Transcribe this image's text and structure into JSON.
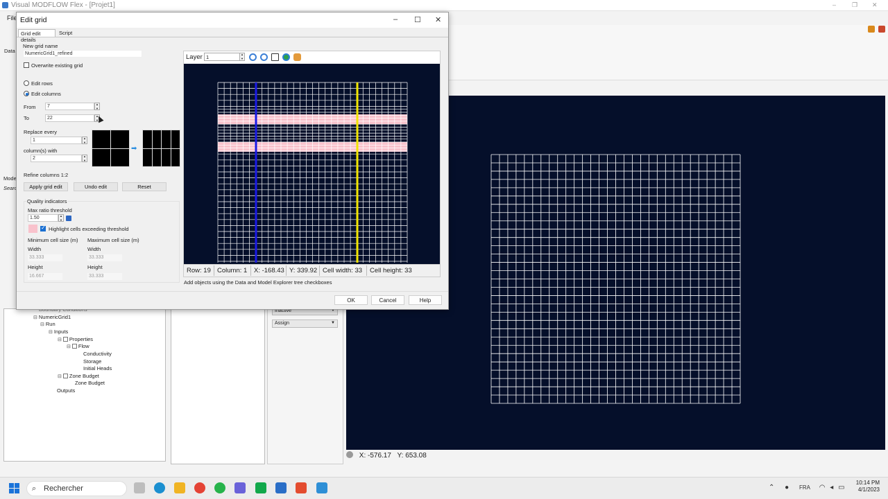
{
  "app": {
    "title": "Visual MODFLOW Flex - [Projet1]",
    "menu_first": "File",
    "panel_label_data": "Data",
    "panel_label_model": "Mode",
    "panel_label_search": "Searc"
  },
  "background_tree": {
    "boundary": "Boundary Conditions",
    "grid": "NumericGrid1",
    "run": "Run",
    "inputs": "Inputs",
    "properties": "Properties",
    "flow": "Flow",
    "conductivity": "Conductivity",
    "storage": "Storage",
    "initial_heads": "Initial Heads",
    "zone_budget": "Zone Budget",
    "zone_budget_child": "Zone Budget",
    "outputs": "Outputs"
  },
  "background_props": {
    "dropdown1": "Inactive",
    "dropdown2": "Assign"
  },
  "background_coords": {
    "x": "X: -576.17",
    "y": "Y: 653.08"
  },
  "dialog": {
    "title": "Edit grid",
    "tabs": [
      "Grid edit details",
      "Script"
    ],
    "new_grid_name_label": "New grid name",
    "new_grid_name_value": "NumericGrid1_refined",
    "overwrite_label": "Overwrite existing grid",
    "overwrite_checked": false,
    "edit_rows_label": "Edit rows",
    "edit_columns_label": "Edit columns",
    "edit_mode": "columns",
    "from_label": "From",
    "from_value": "7",
    "to_label": "To",
    "to_value": "22",
    "replace_every_label": "Replace every",
    "replace_every_value": "1",
    "columns_with_label": "column(s) with",
    "columns_with_value": "2",
    "refine_label": "Refine columns 1:2",
    "apply_button": "Apply grid edit",
    "undo_button": "Undo edit",
    "reset_button": "Reset",
    "quality_label": "Quality indicators",
    "max_ratio_label": "Max ratio threshold",
    "max_ratio_value": "1.50",
    "highlight_label": "Highlight cells exceeding threshold",
    "highlight_checked": true,
    "highlight_color": "#f9c2cc",
    "min_cell_label": "Minimum cell size (m)",
    "max_cell_label": "Maximum cell size (m)",
    "width_label": "Width",
    "height_label": "Height",
    "min_width": "33.333",
    "min_height": "16.667",
    "max_width": "33.333",
    "max_height": "33.333",
    "layer_label": "Layer",
    "layer_value": "1",
    "status": {
      "row": "Row: 19",
      "column": "Column: 1",
      "x": "X: -168.43",
      "y": "Y: 339.92",
      "cell_width": "Cell width: 33",
      "cell_height": "Cell height: 33"
    },
    "hint": "Add objects using the Data and Model Explorer tree checkboxes",
    "ok_button": "OK",
    "cancel_button": "Cancel",
    "help_button": "Help"
  },
  "taskbar": {
    "search_placeholder": "Rechercher",
    "lang": "FRA",
    "time": "10:14 PM",
    "date": "4/1/2023"
  },
  "colors": {
    "viewport_bg": "#050f2a",
    "grid_line": "#ffffff",
    "highlight_row": "#f9c2cc",
    "column_blue": "#1a1ae6",
    "column_yellow": "#f2e600"
  },
  "icons": {
    "zoom_in": "zoom-in-icon",
    "zoom_out": "zoom-out-icon",
    "zoom_extent": "zoom-extent-icon",
    "globe": "globe-icon",
    "pan": "pan-hand-icon"
  }
}
